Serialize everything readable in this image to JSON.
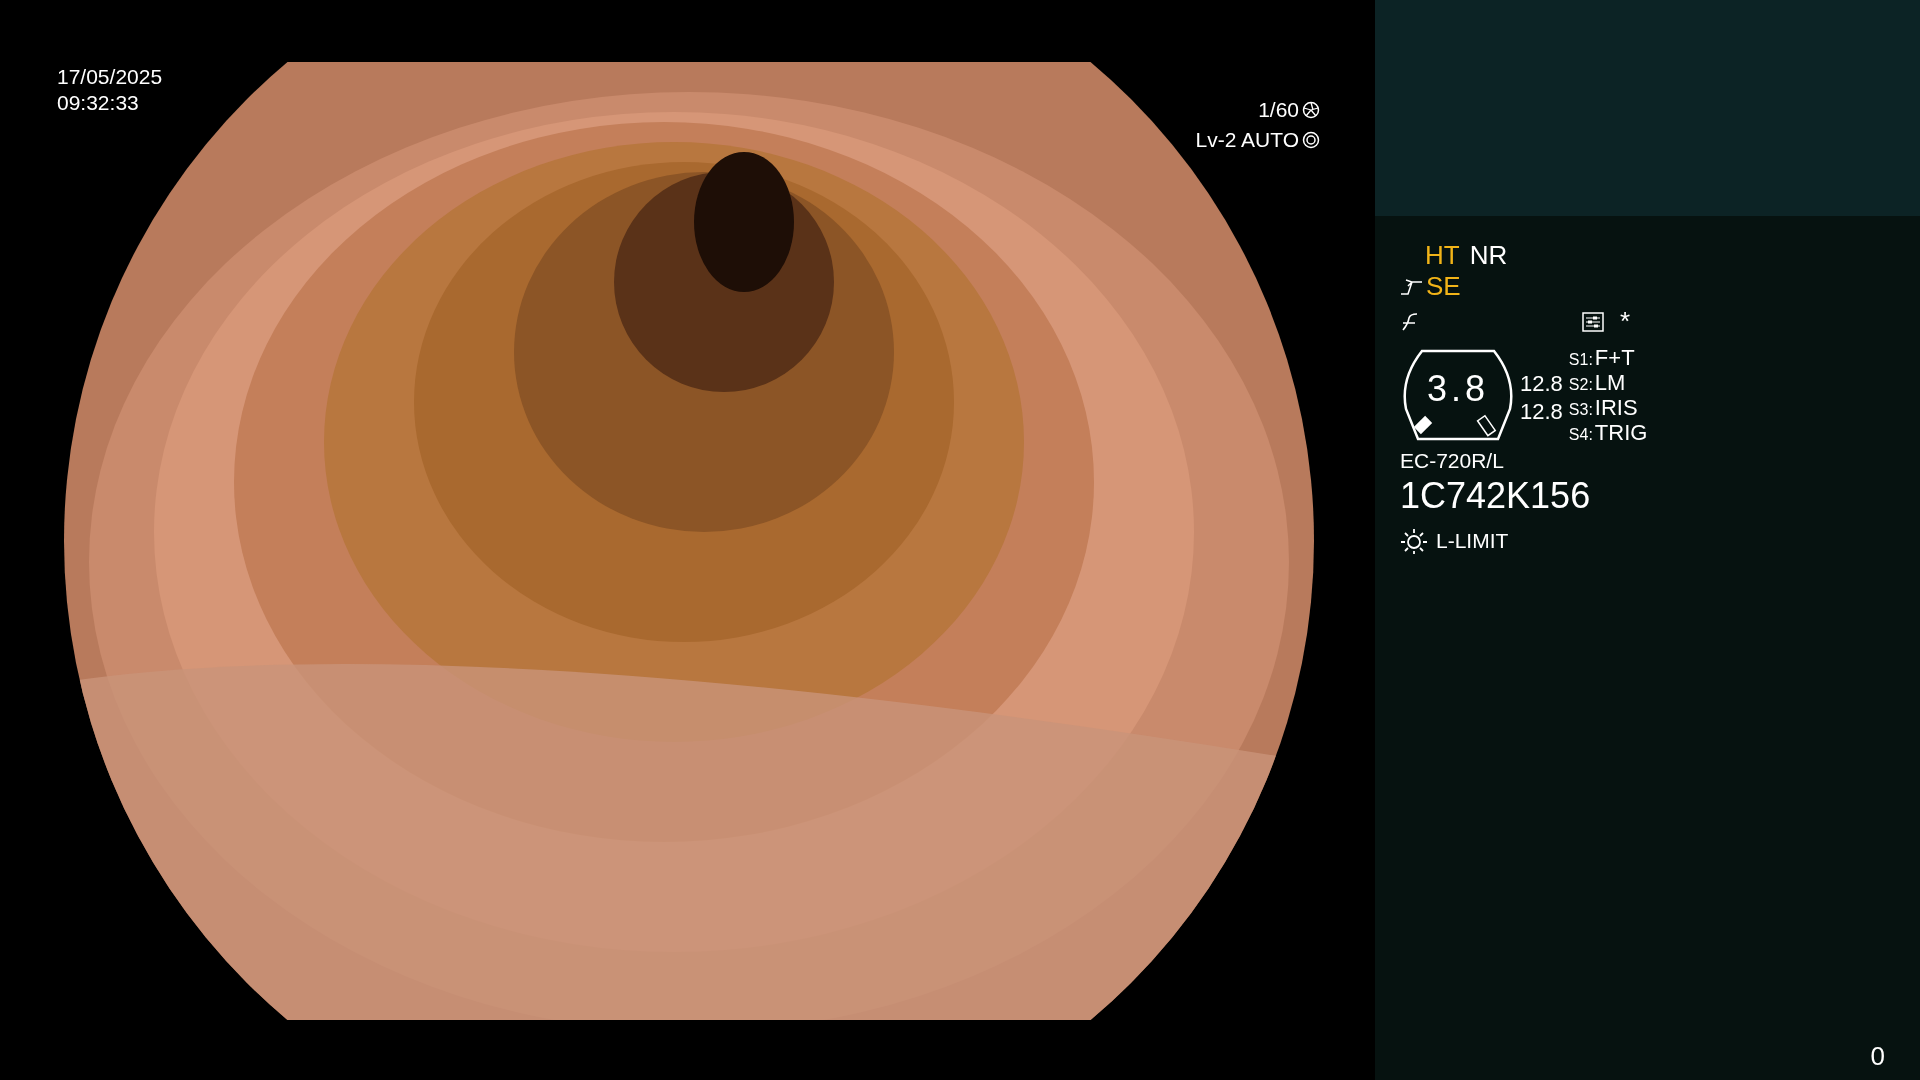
{
  "overlay": {
    "date": "17/05/2025",
    "time": "09:32:33",
    "shutter": "1/60",
    "exposure": "Lv-2 AUTO"
  },
  "modes": [
    {
      "label": "HT",
      "on": true
    },
    {
      "label": "NR",
      "on": false
    }
  ],
  "enhancement": {
    "label": "SE",
    "on": true
  },
  "marker": "*",
  "gauge": {
    "value": "3.8",
    "readings": [
      "12.8",
      "12.8"
    ]
  },
  "switches": [
    {
      "key": "S1:",
      "value": "F+T"
    },
    {
      "key": "S2:",
      "value": "LM"
    },
    {
      "key": "S3:",
      "value": "IRIS"
    },
    {
      "key": "S4:",
      "value": "TRIG"
    }
  ],
  "scope": {
    "model": "EC-720R/L",
    "serial": "1C742K156"
  },
  "light": "L-LIMIT",
  "counter": "0"
}
